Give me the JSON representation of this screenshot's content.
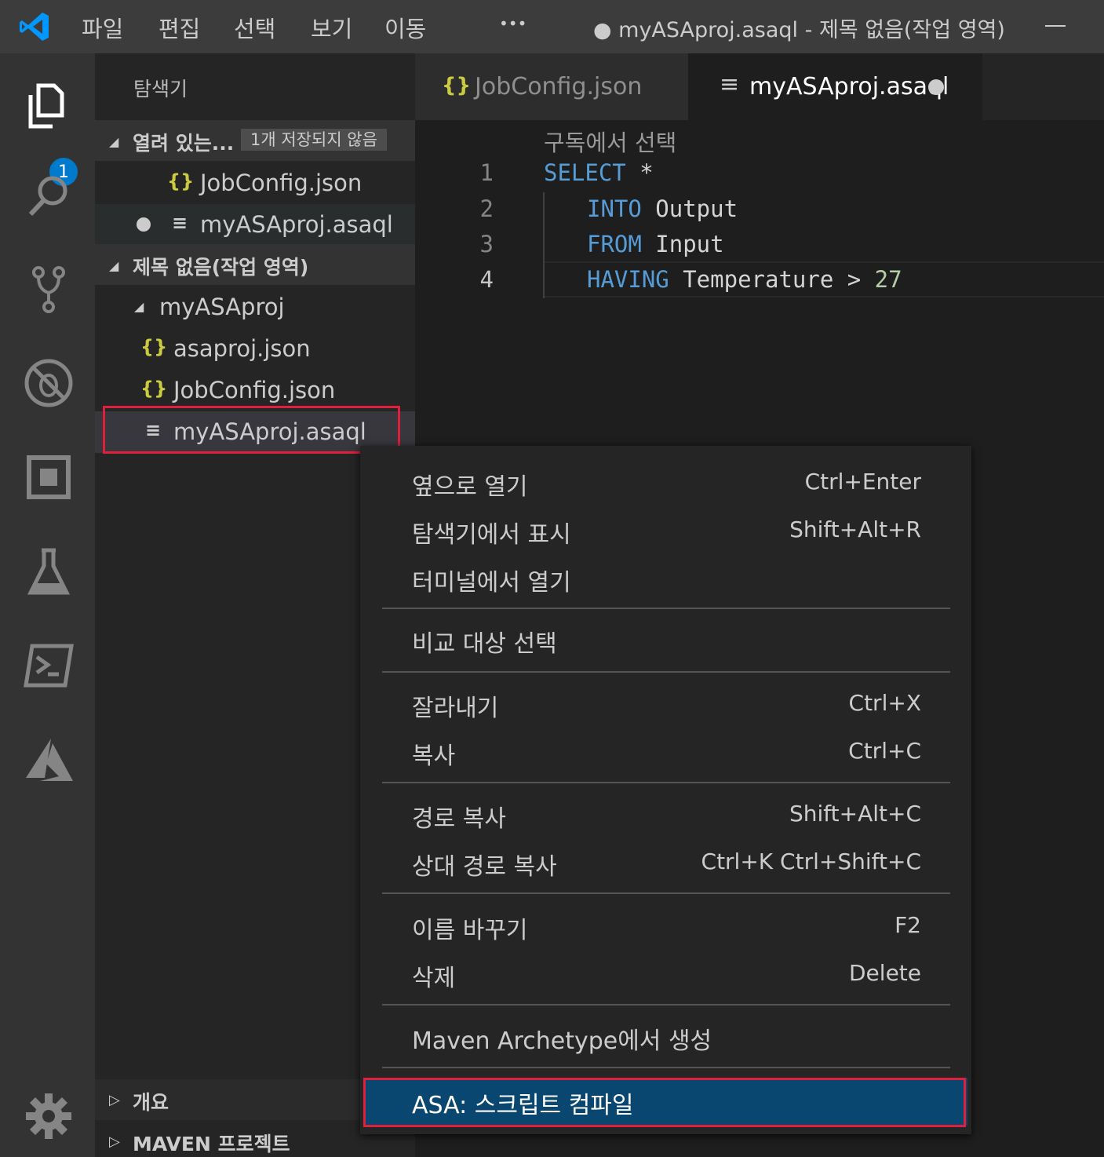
{
  "titlebar": {
    "menu": [
      "파일",
      "편집",
      "선택",
      "보기",
      "이동",
      "•••"
    ],
    "title": "● myASAproj.asaql - 제목 없음(작업 영역)"
  },
  "activitybar": {
    "explorer_badge": "1",
    "icons": [
      "files-icon",
      "search-icon",
      "source-control-icon",
      "no-debug-icon",
      "extensions-icon",
      "flask-icon",
      "terminal-icon",
      "azure-icon",
      "gear-icon"
    ]
  },
  "sidebar": {
    "title": "탐색기",
    "open_editors": {
      "label": "열려 있는...",
      "badge": "1개 저장되지 않음",
      "items": [
        "JobConfig.json",
        "myASAproj.asaql"
      ]
    },
    "workspace": {
      "label": "제목 없음(작업 영역)",
      "folder": "myASAproj",
      "files": [
        "asaproj.json",
        "JobConfig.json",
        "myASAproj.asaql"
      ]
    },
    "outline": "개요",
    "maven": "MAVEN 프로젝트"
  },
  "tabs": [
    {
      "icon": "{}",
      "label": "JobConfig.json"
    },
    {
      "icon": "≡",
      "label": "myASAproj.asaql"
    }
  ],
  "editor": {
    "codelens": "구독에서 선택",
    "line_numbers": [
      "1",
      "2",
      "3",
      "4"
    ],
    "lines": [
      {
        "kw": "SELECT",
        "rest": " *"
      },
      {
        "kw": "INTO",
        "rest": " Output"
      },
      {
        "kw": "FROM",
        "rest": " Input"
      },
      {
        "kw": "HAVING",
        "rest": " Temperature > ",
        "num": "27"
      }
    ]
  },
  "context_menu": {
    "items": [
      {
        "label": "옆으로 열기",
        "shortcut": "Ctrl+Enter"
      },
      {
        "label": "탐색기에서 표시",
        "shortcut": "Shift+Alt+R"
      },
      {
        "label": "터미널에서 열기",
        "shortcut": ""
      },
      {
        "label": "비교 대상 선택",
        "shortcut": ""
      },
      {
        "label": "잘라내기",
        "shortcut": "Ctrl+X"
      },
      {
        "label": "복사",
        "shortcut": "Ctrl+C"
      },
      {
        "label": "경로 복사",
        "shortcut": "Shift+Alt+C"
      },
      {
        "label": "상대 경로 복사",
        "shortcut": "Ctrl+K Ctrl+Shift+C"
      },
      {
        "label": "이름 바꾸기",
        "shortcut": "F2"
      },
      {
        "label": "삭제",
        "shortcut": "Delete"
      },
      {
        "label": "Maven Archetype에서 생성",
        "shortcut": ""
      },
      {
        "label": "ASA: 스크립트 컴파일",
        "shortcut": ""
      }
    ]
  },
  "colors": {
    "accent": "#007acc",
    "highlight_border": "#e01f3d",
    "menu_selection": "#094771",
    "keyword": "#569cd6",
    "number": "#b5cea8",
    "json_icon": "#cbcb41"
  }
}
